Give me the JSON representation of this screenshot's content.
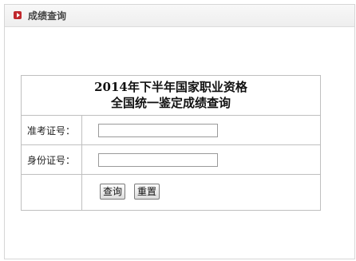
{
  "header": {
    "title": "成绩查询"
  },
  "form": {
    "title_line1": "2014年下半年国家职业资格",
    "title_line2": "全国统一鉴定成绩查询",
    "fields": [
      {
        "label": "准考证号：",
        "value": "",
        "placeholder": ""
      },
      {
        "label": "身份证号：",
        "value": "",
        "placeholder": ""
      }
    ],
    "query_button": "查询",
    "reset_button": "重置"
  },
  "colors": {
    "icon_red": "#c0282d",
    "border": "#bfbfbf",
    "header_bg": "#eeeeee"
  }
}
